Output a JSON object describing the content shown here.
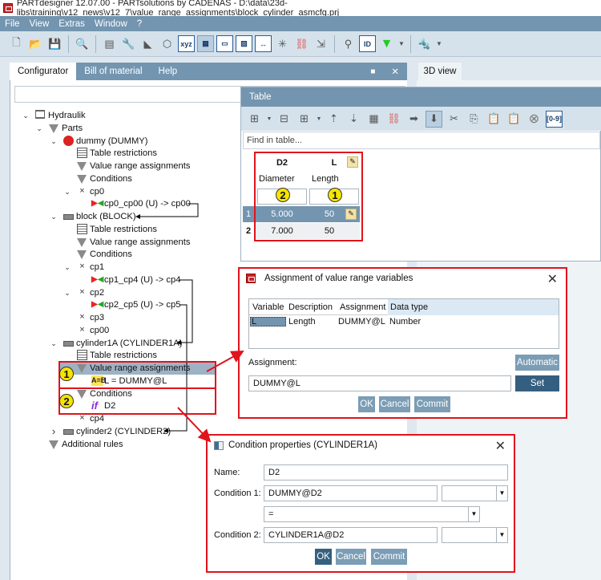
{
  "window": {
    "title": "PARTdesigner 12.07.00 - PARTsolutions by CADENAS - D:\\data\\23d-libs\\training\\v12_news\\v12_7\\value_range_assignments\\block_cylinder_asmcfg.prj"
  },
  "menu": [
    "File",
    "View",
    "Extras",
    "Window",
    "?"
  ],
  "left_panel": {
    "tabs": [
      "Configurator",
      "Bill of material",
      "Help"
    ]
  },
  "right_panel": {
    "tab": "3D view"
  },
  "tree": [
    {
      "label": "Hydraulik",
      "level": 0,
      "icon": "assembly-icon",
      "exp": "down"
    },
    {
      "label": "Parts",
      "level": 1,
      "icon": "funnel-icon",
      "exp": "down"
    },
    {
      "label": "dummy (DUMMY)",
      "level": 2,
      "icon": "dummy-part-icon",
      "exp": "down"
    },
    {
      "label": "Table restrictions",
      "level": 3,
      "icon": "table-icon"
    },
    {
      "label": "Value range assignments",
      "level": 3,
      "icon": "funnel-icon"
    },
    {
      "label": "Conditions",
      "level": 3,
      "icon": "funnel-icon"
    },
    {
      "label": "cp0",
      "level": 3,
      "icon": "connection-point-icon",
      "exp": "down"
    },
    {
      "label": "cp0_cp00 (U) -> cp00",
      "level": 4,
      "icon": "connector-icon"
    },
    {
      "label": "block (BLOCK)",
      "level": 2,
      "icon": "part-icon",
      "exp": "down"
    },
    {
      "label": "Table restrictions",
      "level": 3,
      "icon": "table-icon"
    },
    {
      "label": "Value range assignments",
      "level": 3,
      "icon": "funnel-icon"
    },
    {
      "label": "Conditions",
      "level": 3,
      "icon": "funnel-icon"
    },
    {
      "label": "cp1",
      "level": 3,
      "icon": "connection-point-icon",
      "exp": "down"
    },
    {
      "label": "cp1_cp4 (U) -> cp4",
      "level": 4,
      "icon": "connector-icon"
    },
    {
      "label": "cp2",
      "level": 3,
      "icon": "connection-point-icon",
      "exp": "down"
    },
    {
      "label": "cp2_cp5 (U) -> cp5",
      "level": 4,
      "icon": "connector-icon"
    },
    {
      "label": "cp3",
      "level": 3,
      "icon": "connection-point-icon"
    },
    {
      "label": "cp00",
      "level": 3,
      "icon": "connection-point-icon"
    },
    {
      "label": "cylinder1A (CYLINDER1A)",
      "level": 2,
      "icon": "part-icon",
      "exp": "down"
    },
    {
      "label": "Table restrictions",
      "level": 3,
      "icon": "table-icon"
    },
    {
      "label": "Value range assignments",
      "level": 3,
      "icon": "funnel-icon",
      "exp": "down",
      "selected": true
    },
    {
      "label": "L = DUMMY@L",
      "level": 4,
      "icon": "assignment-icon"
    },
    {
      "label": "Conditions",
      "level": 3,
      "icon": "funnel-icon",
      "exp": "down"
    },
    {
      "label": "D2",
      "level": 4,
      "icon": "if-icon"
    },
    {
      "label": "cp4",
      "level": 3,
      "icon": "connection-point-icon"
    },
    {
      "label": "cylinder2 (CYLINDER2)",
      "level": 2,
      "icon": "part-icon",
      "exp": "right"
    },
    {
      "label": "Additional rules",
      "level": 1,
      "icon": "funnel-icon"
    }
  ],
  "badges": {
    "one": "1",
    "two": "2"
  },
  "table_panel": {
    "title": "Table",
    "find_placeholder": "Find in table...",
    "columns": [
      {
        "name": "D2",
        "desc": "Diameter"
      },
      {
        "name": "L",
        "desc": "Length"
      }
    ],
    "rows": [
      {
        "num": "1",
        "D2": "5.000",
        "L": "50"
      },
      {
        "num": "2",
        "D2": "7.000",
        "L": "50"
      }
    ],
    "range_button": "[0-9]"
  },
  "assign_dialog": {
    "title": "Assignment of value range variables",
    "columns": [
      "Variable",
      "Description",
      "Assignment",
      "Data type"
    ],
    "row": [
      "L",
      "Length",
      "DUMMY@L",
      "Number"
    ],
    "assignment_label": "Assignment:",
    "assignment_value": "DUMMY@L",
    "automatic": "Automatic",
    "set": "Set",
    "ok": "OK",
    "cancel": "Cancel",
    "commit": "Commit"
  },
  "cond_dialog": {
    "title": "Condition properties (CYLINDER1A)",
    "name_label": "Name:",
    "name_value": "D2",
    "cond1_label": "Condition 1:",
    "cond1_value": "DUMMY@D2",
    "operator": "=",
    "cond2_label": "Condition 2:",
    "cond2_value": "CYLINDER1A@D2",
    "ok": "OK",
    "cancel": "Cancel",
    "commit": "Commit"
  },
  "colors": {
    "accent": "#7395b0",
    "annotation": "#e0141c",
    "badge": "#f5e400",
    "dark_button": "#355f80"
  }
}
